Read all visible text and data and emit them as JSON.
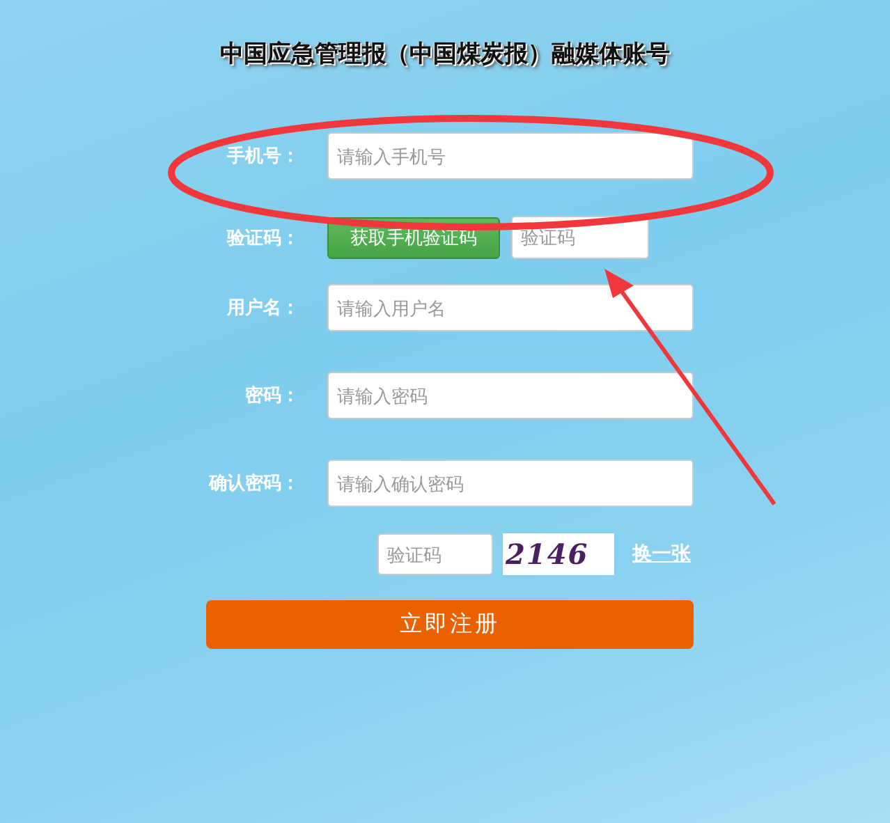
{
  "title": "中国应急管理报（中国煤炭报）融媒体账号",
  "fields": [
    {
      "label": "手机号：",
      "placeholder": "请输入手机号",
      "kind": "text"
    },
    {
      "label": "验证码：",
      "kind": "sms",
      "button": "获取手机验证码",
      "placeholder": "验证码"
    },
    {
      "label": "用户名：",
      "placeholder": "请输入用户名",
      "kind": "text"
    },
    {
      "label": "密码：",
      "placeholder": "请输入密码",
      "kind": "text"
    },
    {
      "label": "确认密码：",
      "placeholder": "请输入确认密码",
      "kind": "text"
    }
  ],
  "captcha": {
    "placeholder": "验证码",
    "code": "2146",
    "refresh_link": "换一张"
  },
  "submit_button": "立即注册"
}
